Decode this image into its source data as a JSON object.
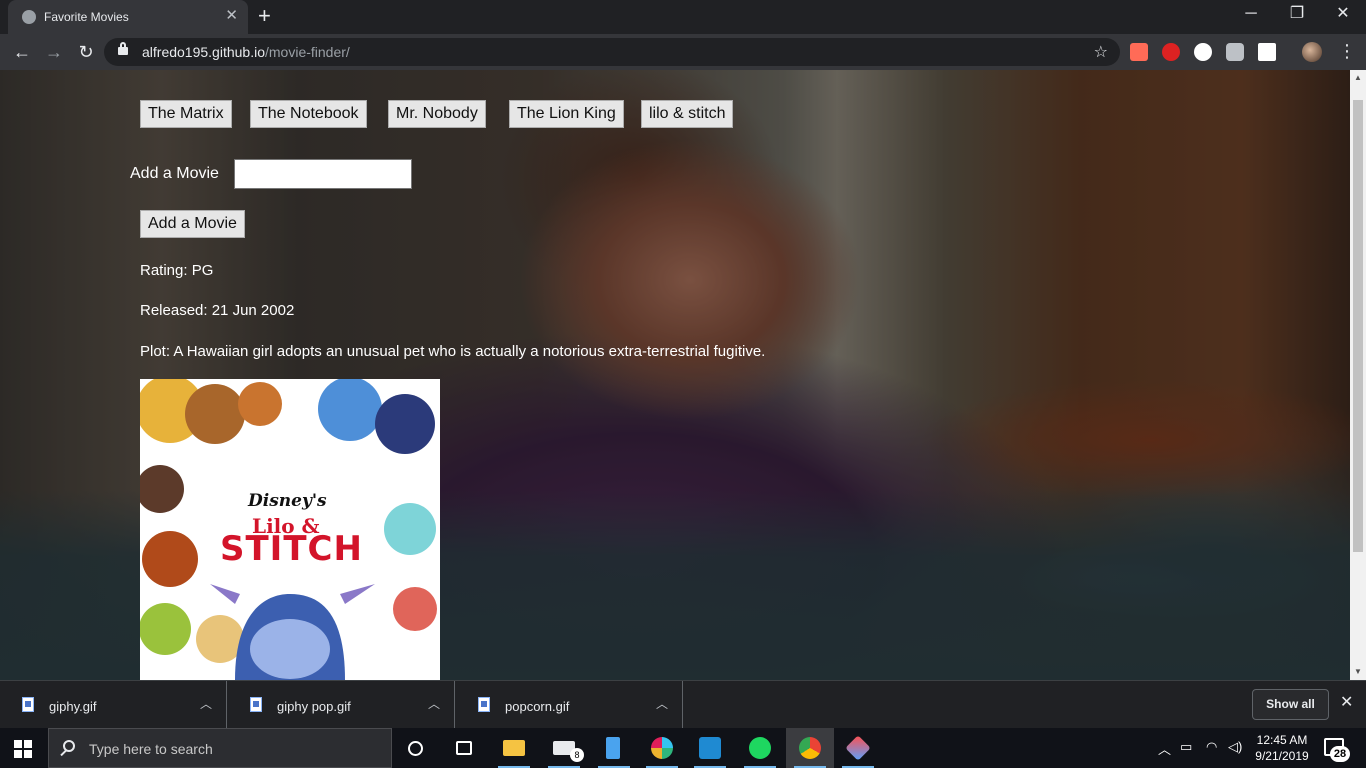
{
  "browser": {
    "tab_title": "Favorite Movies",
    "new_tab_symbol": "+",
    "url_host": "alfredo195.github.io",
    "url_path": "/movie-finder/",
    "icons": [
      "globe-icon",
      "close-icon",
      "back-icon",
      "forward-icon",
      "reload-icon",
      "lock-icon",
      "bookmark-star-icon",
      "menu-icon"
    ]
  },
  "page": {
    "movie_buttons": [
      "The Matrix",
      "The Notebook",
      "Mr. Nobody",
      "The Lion King",
      "lilo & stitch"
    ],
    "add_label": "Add a Movie",
    "add_input_value": "",
    "add_button": "Add a Movie",
    "rating": "Rating: PG",
    "released": "Released: 21 Jun 2002",
    "plot": "Plot: A Hawaiian girl adopts an unusual pet who is actually a notorious extra-terrestrial fugitive.",
    "poster": {
      "brand": "Disney's",
      "title_top": "Lilo &",
      "title_bottom": "STITCH"
    }
  },
  "downloads": {
    "items": [
      "giphy.gif",
      "giphy pop.gif",
      "popcorn.gif"
    ],
    "show_all": "Show all"
  },
  "taskbar": {
    "search_placeholder": "Type here to search",
    "mail_badge": "8",
    "time": "12:45 AM",
    "date": "9/21/2019",
    "notification_count": "28",
    "accent": "#76b9ed"
  }
}
